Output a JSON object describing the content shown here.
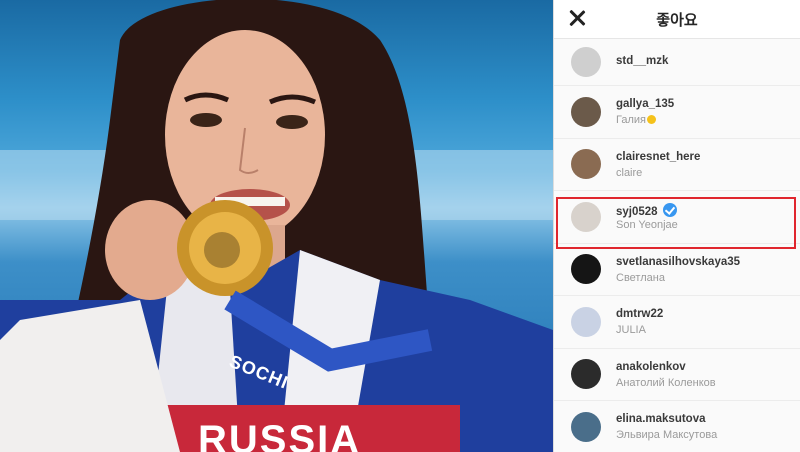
{
  "panel": {
    "title": "좋아요",
    "close_icon": "close-icon"
  },
  "likes": [
    {
      "username": "std__mzk",
      "fullname": "",
      "avatar_color": "#cfcfcf"
    },
    {
      "username": "gallya_135",
      "fullname": "Галия",
      "avatar_color": "#6b5a4a",
      "emoji": true
    },
    {
      "username": "clairesnet_here",
      "fullname": "claire",
      "avatar_color": "#8a6b52"
    },
    {
      "username": "syj0528",
      "fullname": "Son Yeonjae",
      "avatar_color": "#d8d2cc",
      "verified": true,
      "highlighted": true
    },
    {
      "username": "svetlanasilhovskaya35",
      "fullname": "Светлана",
      "avatar_color": "#151515"
    },
    {
      "username": "dmtrw22",
      "fullname": "JULIA",
      "avatar_color": "#c9d2e4"
    },
    {
      "username": "anakolenkov",
      "fullname": "Анатолий Коленков",
      "avatar_color": "#2b2b2b"
    },
    {
      "username": "elina.maksutova",
      "fullname": "Эльвира Максутова",
      "avatar_color": "#4a6e8a"
    }
  ],
  "photo": {
    "jacket_text_1": "SOCHI",
    "jacket_text_2": "RUSSIA"
  },
  "colors": {
    "highlight_border": "#e0262e",
    "verified_badge": "#3897f0"
  }
}
